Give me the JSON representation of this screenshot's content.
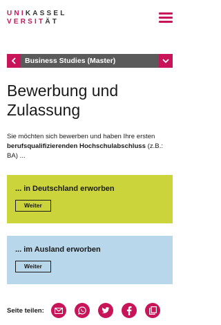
{
  "header": {
    "logo_line1_a": "UNI",
    "logo_line1_b": "KASSEL",
    "logo_line2_a": "VERSIT",
    "logo_line2_b": "ÄT",
    "menu_icon": "hamburger-menu-icon"
  },
  "breadcrumb": {
    "label": "Business Studies (Master)",
    "prev_icon": "chevron-left-icon",
    "toggle_icon": "chevron-down-icon"
  },
  "main": {
    "title": "Bewerbung und Zulassung",
    "intro_plain": "Sie möchten sich bewerben und haben Ihre ersten ",
    "intro_bold": "berufsqualifizierenden Hochschulabschluss",
    "intro_tail": " (z.B.: BA) ..."
  },
  "options": [
    {
      "title": "... in Deutschland erworben",
      "button": "Weiter",
      "color": "#cbd53b"
    },
    {
      "title": "... im Ausland erworben",
      "button": "Weiter",
      "color": "#b9d7ea"
    }
  ],
  "share": {
    "label": "Seite teilen:",
    "icons": [
      "email-icon",
      "whatsapp-icon",
      "twitter-icon",
      "facebook-icon",
      "copy-icon"
    ]
  },
  "colors": {
    "accent": "#c8155a",
    "breadcrumb_bg": "#5a5a5a"
  }
}
